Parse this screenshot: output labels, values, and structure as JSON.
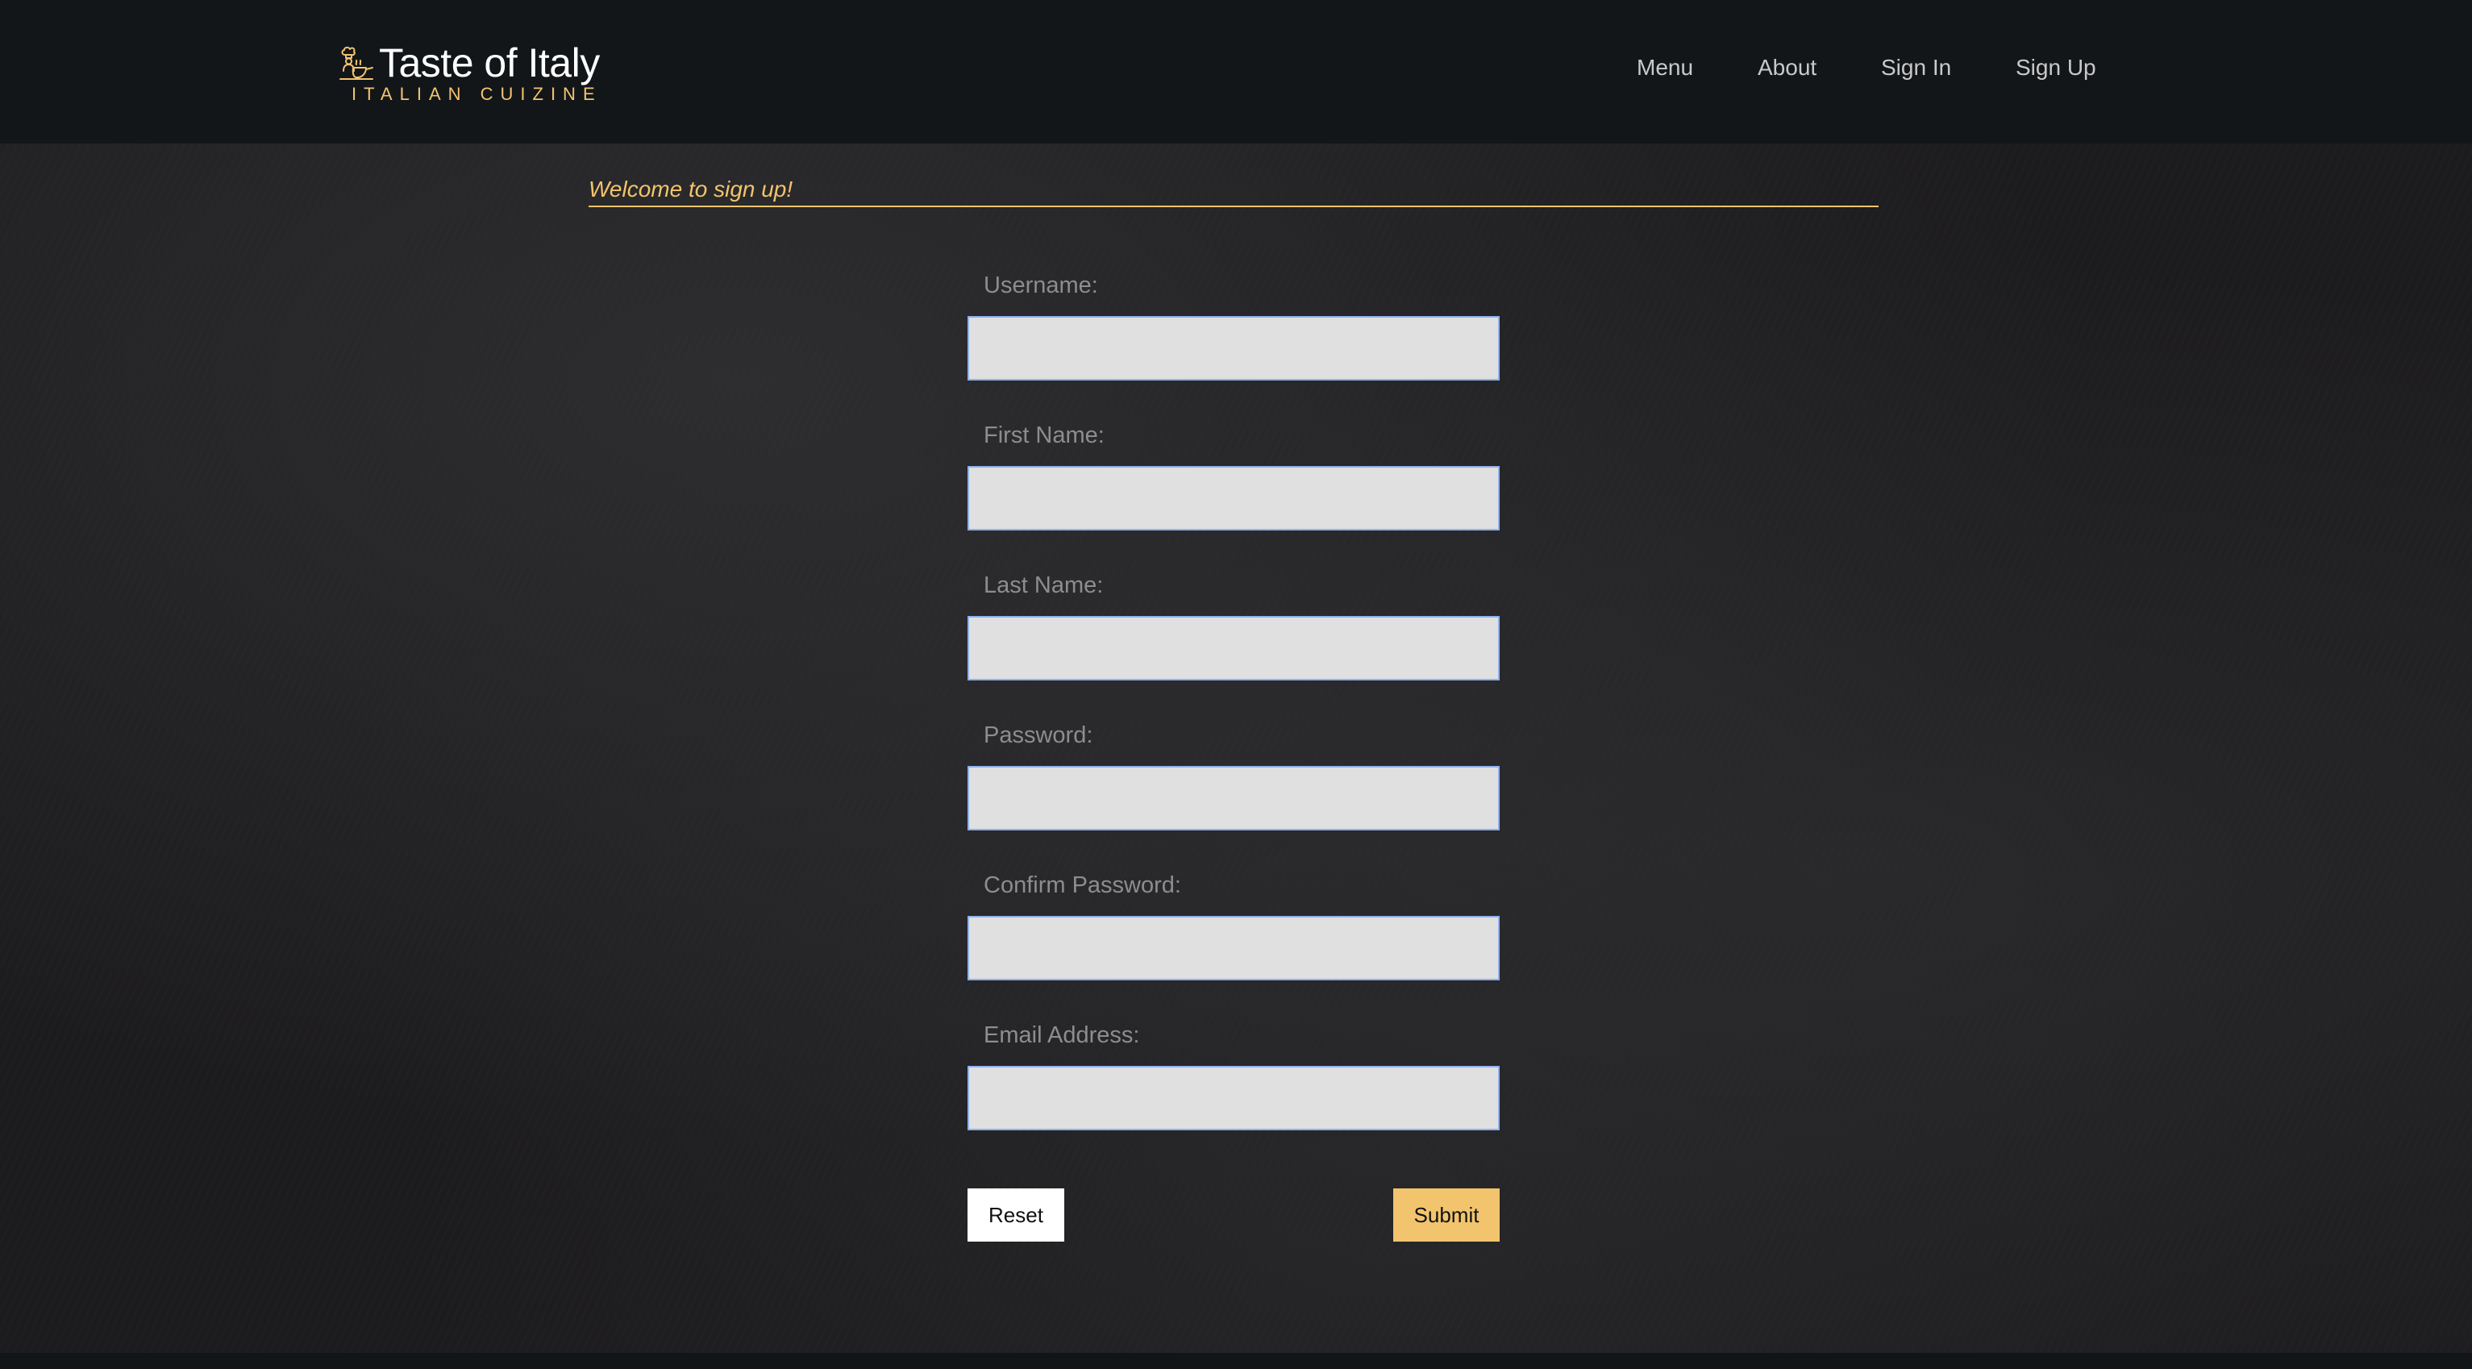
{
  "header": {
    "brand_title": "Taste of Italy",
    "brand_subtitle": "ITALIAN CUIZINE",
    "brand_icon": "chef-cooking-icon",
    "nav": {
      "menu": "Menu",
      "about": "About",
      "sign_in": "Sign In",
      "sign_up": "Sign Up"
    }
  },
  "main": {
    "welcome": "Welcome to sign up!",
    "form": {
      "username_label": "Username:",
      "username_value": "",
      "first_name_label": "First Name:",
      "first_name_value": "",
      "last_name_label": "Last Name:",
      "last_name_value": "",
      "password_label": "Password:",
      "password_value": "",
      "confirm_password_label": "Confirm Password:",
      "confirm_password_value": "",
      "email_label": "Email Address:",
      "email_value": ""
    },
    "buttons": {
      "reset": "Reset",
      "submit": "Submit"
    }
  },
  "colors": {
    "accent": "#f2c46d",
    "header_bg": "#131619",
    "input_bg": "#e0e0e0",
    "input_border": "#8fb0ec"
  }
}
